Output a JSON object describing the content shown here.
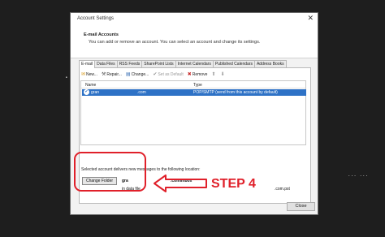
{
  "window": {
    "title": "Account Settings"
  },
  "header": {
    "title": "E-mail Accounts",
    "subtitle": "You can add or remove an account. You can select an account and change its settings."
  },
  "tabs": [
    "E-mail",
    "Data Files",
    "RSS Feeds",
    "SharePoint Lists",
    "Internet Calendars",
    "Published Calendars",
    "Address Books"
  ],
  "toolbar": {
    "new": "New...",
    "repair": "Repair...",
    "change": "Change...",
    "set_default": "Set as Default",
    "remove": "Remove"
  },
  "list": {
    "col_name": "Name",
    "col_type": "Type",
    "rows": [
      {
        "name": "gran",
        "mid": ".com",
        "type": "POP/SMTP (send from this account by default)"
      }
    ]
  },
  "delivery": {
    "text": "Selected account delivers new messages to the following location:",
    "change_folder": "Change Folder",
    "account": "gra",
    "inbox": ".com\\Inbox",
    "in_data_file": "in data file",
    "pst": ".com.pst"
  },
  "annotation": {
    "step": "STEP 4",
    "color": "#e0202a"
  },
  "footer": {
    "close": "Close"
  }
}
